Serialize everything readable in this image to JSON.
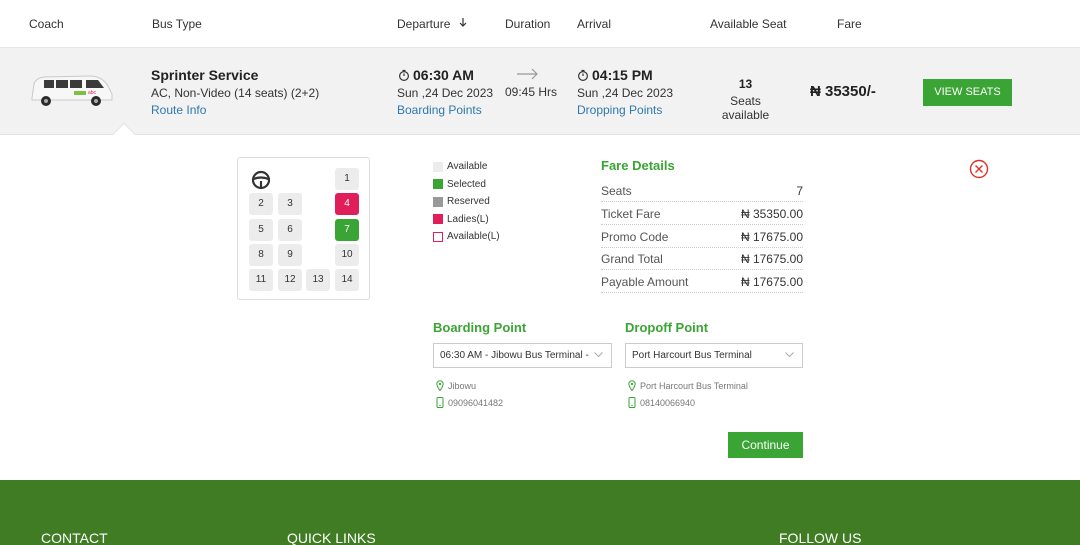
{
  "header": {
    "coach": "Coach",
    "bus_type": "Bus Type",
    "departure": "Departure",
    "duration": "Duration",
    "arrival": "Arrival",
    "available_seat": "Available Seat",
    "fare": "Fare"
  },
  "trip": {
    "service_name": "Sprinter Service",
    "service_type": "AC, Non-Video (14 seats) (2+2)",
    "route_info": "Route Info",
    "departure_time": "06:30 AM",
    "departure_date": "Sun ,24 Dec 2023",
    "boarding_points": "Boarding Points",
    "duration": "09:45 Hrs",
    "arrival_time": "04:15 PM",
    "arrival_date": "Sun ,24 Dec 2023",
    "dropping_points": "Dropping Points",
    "seats_count": "13",
    "seats_available": "Seats available",
    "fare": "₦ 35350/-",
    "view_seats": "VIEW SEATS"
  },
  "seat_map": {
    "seats": [
      {
        "n": "1",
        "state": "available"
      },
      {
        "n": "2",
        "state": "available"
      },
      {
        "n": "3",
        "state": "available"
      },
      {
        "n": "4",
        "state": "ladies"
      },
      {
        "n": "5",
        "state": "available"
      },
      {
        "n": "6",
        "state": "available"
      },
      {
        "n": "7",
        "state": "selected"
      },
      {
        "n": "8",
        "state": "available"
      },
      {
        "n": "9",
        "state": "available"
      },
      {
        "n": "10",
        "state": "available"
      },
      {
        "n": "11",
        "state": "available"
      },
      {
        "n": "12",
        "state": "available"
      },
      {
        "n": "13",
        "state": "available"
      },
      {
        "n": "14",
        "state": "available"
      }
    ]
  },
  "legend": {
    "available": "Available",
    "selected": "Selected",
    "reserved": "Reserved",
    "ladies": "Ladies(L)",
    "available_l": "Available(L)"
  },
  "fare_details": {
    "title": "Fare Details",
    "seats_label": "Seats",
    "seats_value": "7",
    "ticket_label": "Ticket Fare",
    "ticket_value": "₦ 35350.00",
    "promo_label": "Promo Code",
    "promo_value": "₦ 17675.00",
    "grand_label": "Grand Total",
    "grand_value": "₦ 17675.00",
    "payable_label": "Payable Amount",
    "payable_value": "₦ 17675.00"
  },
  "boarding": {
    "title": "Boarding Point",
    "selected": "06:30 AM - Jibowu Bus Terminal -",
    "location": "Jibowu",
    "phone": "09096041482"
  },
  "dropoff": {
    "title": "Dropoff Point",
    "selected": "Port Harcourt Bus Terminal",
    "location": "Port Harcourt Bus Terminal",
    "phone": "08140066940"
  },
  "continue_label": "Continue",
  "footer": {
    "contact": "CONTACT",
    "quick_links": "QUICK LINKS",
    "follow_us": "FOLLOW US"
  },
  "colors": {
    "accent": "#3aa535",
    "ladies": "#e01e5a",
    "reserved": "#999999",
    "link": "#2e78b0",
    "footer": "#3f7c23"
  }
}
